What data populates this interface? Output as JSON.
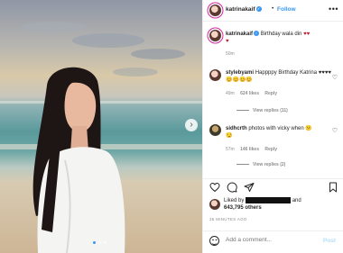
{
  "header": {
    "username": "katrinakaif",
    "separator": "•",
    "follow_label": "Follow",
    "more_icon": "•••"
  },
  "caption": {
    "username": "katrinakaif",
    "text": "Birthday wala din",
    "emoji": "♥♥",
    "extra_emoji": "♥",
    "age": "50m"
  },
  "comments": [
    {
      "username": "stylebyami",
      "text": "Happppy Birthday Katrina ♥♥♥♥",
      "emoji": "😊😊😊😊",
      "age": "49m",
      "likes": "624 likes",
      "reply": "Reply",
      "view_replies": "View replies (11)"
    },
    {
      "username": "sidhcrth",
      "text": "photos with vicky when",
      "emoji": "😕",
      "emoji2": "😏",
      "age": "57m",
      "likes": "146 likes",
      "reply": "Reply",
      "view_replies": "View replies (2)"
    }
  ],
  "likes": {
    "prefix": "Liked by",
    "suffix": "and",
    "count": "643,795 others"
  },
  "timestamp": "36 MINUTES AGO",
  "add_comment": {
    "placeholder": "Add a comment...",
    "post_label": "Post"
  },
  "photo": {
    "next_arrow": "›",
    "carousel_total": 3,
    "carousel_index": 1
  },
  "colors": {
    "accent": "#3897f0",
    "heart_red": "#c0192a",
    "story_ring": "#d6249f"
  }
}
